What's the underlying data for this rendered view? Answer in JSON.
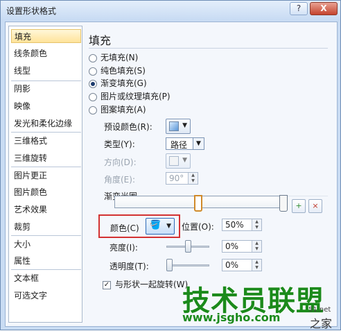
{
  "window": {
    "title": "设置形状格式",
    "help_label": "?",
    "close_label": "X"
  },
  "nav": {
    "items": [
      {
        "label": "填充"
      },
      {
        "label": "线条颜色"
      },
      {
        "label": "线型"
      },
      {
        "label": "阴影"
      },
      {
        "label": "映像"
      },
      {
        "label": "发光和柔化边缘"
      },
      {
        "label": "三维格式"
      },
      {
        "label": "三维旋转"
      },
      {
        "label": "图片更正"
      },
      {
        "label": "图片颜色"
      },
      {
        "label": "艺术效果"
      },
      {
        "label": "裁剪"
      },
      {
        "label": "大小"
      },
      {
        "label": "属性"
      },
      {
        "label": "文本框"
      },
      {
        "label": "可选文字"
      }
    ],
    "selected_index": 0
  },
  "fill": {
    "heading": "填充",
    "options": [
      {
        "label": "无填充(N)",
        "selected": false
      },
      {
        "label": "纯色填充(S)",
        "selected": false
      },
      {
        "label": "渐变填充(G)",
        "selected": true
      },
      {
        "label": "图片或纹理填充(P)",
        "selected": false
      },
      {
        "label": "图案填充(A)",
        "selected": false
      }
    ],
    "preset_label": "预设颜色(R):",
    "type_label": "类型(Y):",
    "type_value": "路径",
    "direction_label": "方向(D):",
    "angle_label": "角度(E):",
    "angle_value": "90°",
    "stops_label": "渐变光圈",
    "color_label": "颜色(C)",
    "position_label": "位置(O):",
    "position_value": "50%",
    "brightness_label": "亮度(I):",
    "brightness_value": "0%",
    "transparency_label": "透明度(T):",
    "transparency_value": "0%",
    "rotate_label": "与形状一起旋转(W)",
    "rotate_checked": true
  },
  "watermark": {
    "main": "技术员联盟",
    "url": "www.jsgho.com",
    "small": "51.net",
    "small2": "之家"
  }
}
